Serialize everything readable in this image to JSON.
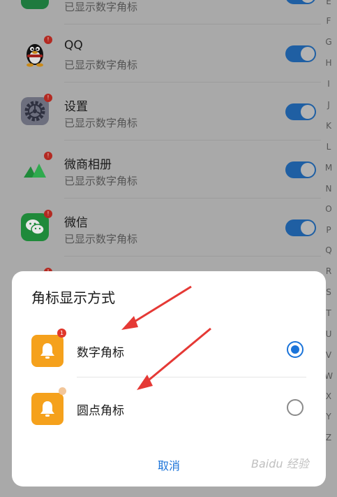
{
  "list": {
    "items": [
      {
        "name": "",
        "sub": "已显示数字角标",
        "icon": "phone-icon",
        "enabled": true
      },
      {
        "name": "QQ",
        "sub": "已显示数字角标",
        "icon": "qq-penguin-icon",
        "enabled": true
      },
      {
        "name": "设置",
        "sub": "已显示数字角标",
        "icon": "settings-gear-icon",
        "enabled": true
      },
      {
        "name": "微商相册",
        "sub": "已显示数字角标",
        "icon": "album-icon",
        "enabled": true
      },
      {
        "name": "微信",
        "sub": "已显示数字角标",
        "icon": "wechat-icon",
        "enabled": true
      }
    ],
    "badge": "!"
  },
  "alphabet": [
    "E",
    "F",
    "G",
    "H",
    "I",
    "J",
    "K",
    "L",
    "M",
    "N",
    "O",
    "P",
    "Q",
    "R",
    "S",
    "T",
    "U",
    "V",
    "W",
    "X",
    "Y",
    "Z"
  ],
  "dialog": {
    "title": "角标显示方式",
    "options": [
      {
        "label": "数字角标",
        "selected": true,
        "badge": "1"
      },
      {
        "label": "圆点角标",
        "selected": false
      }
    ],
    "cancel": "取消"
  },
  "watermark": "Baidu 经验",
  "colors": {
    "accent": "#1a73d9",
    "bell": "#f5a11c",
    "badge": "#e0372b",
    "arrow": "#e53935"
  }
}
